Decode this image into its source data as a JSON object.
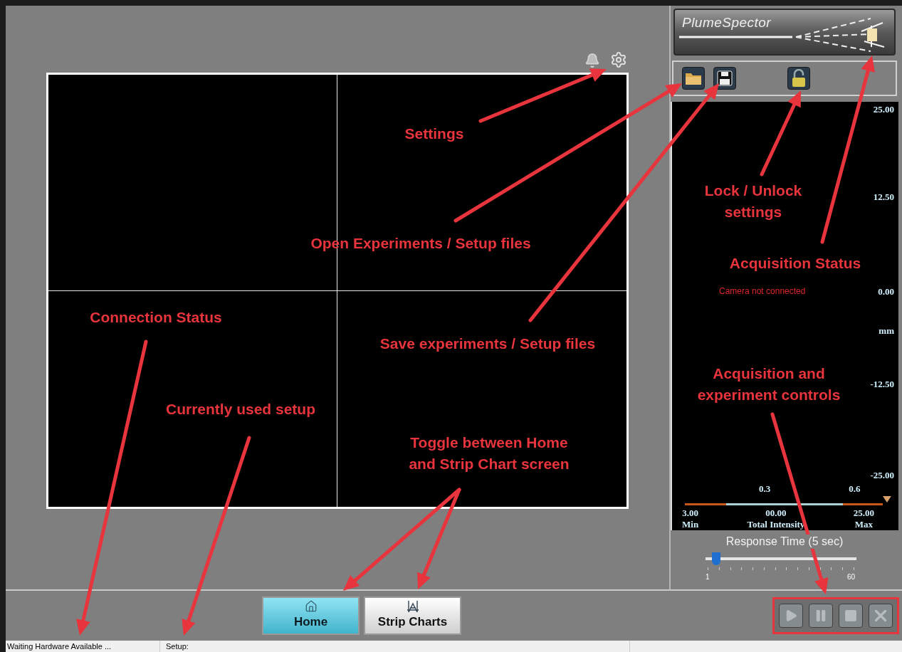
{
  "logo": {
    "text": "PlumeSpector"
  },
  "toolbar": {
    "locked": false
  },
  "chart_panel": {
    "axis_labels": [
      "25.00",
      "12.50",
      "0.00",
      "-12.50",
      "-25.00"
    ],
    "unit": "mm",
    "status_message": "Camera not connected",
    "intensity": {
      "scale_labels": [
        "0.3",
        "0.6"
      ],
      "readouts": [
        {
          "value": "3.00",
          "label": "Min"
        },
        {
          "value": "00.00",
          "label": "Total Intensity"
        },
        {
          "value": "25.00",
          "label": "Max"
        }
      ]
    }
  },
  "response_time": {
    "label": "Response Time (5 sec)",
    "level": 0.07,
    "min_label": "1",
    "max_label": "60"
  },
  "nav_tabs": [
    {
      "label": "Home",
      "kind": "home",
      "selected": true
    },
    {
      "label": "Strip Charts",
      "kind": "charts",
      "selected": false
    }
  ],
  "controls": [
    {
      "kind": "play",
      "disabled": true
    },
    {
      "kind": "pause",
      "disabled": true
    },
    {
      "kind": "stop",
      "disabled": true
    },
    {
      "kind": "close",
      "disabled": true
    }
  ],
  "status_bar": {
    "connection": "Waiting Hardware Available ...",
    "setup": "Setup:"
  },
  "annotations": [
    {
      "lines": [
        "Settings"
      ]
    },
    {
      "lines": [
        "Open Experiments / Setup files"
      ]
    },
    {
      "lines": [
        "Save experiments / Setup files"
      ]
    },
    {
      "lines": [
        "Lock / Unlock",
        "settings"
      ]
    },
    {
      "lines": [
        "Acquisition Status"
      ]
    },
    {
      "lines": [
        "Connection Status"
      ]
    },
    {
      "lines": [
        "Currently used setup"
      ]
    },
    {
      "lines": [
        "Toggle between Home",
        "and Strip Chart screen"
      ]
    },
    {
      "lines": [
        "Acquisition and",
        "experiment controls"
      ]
    }
  ]
}
